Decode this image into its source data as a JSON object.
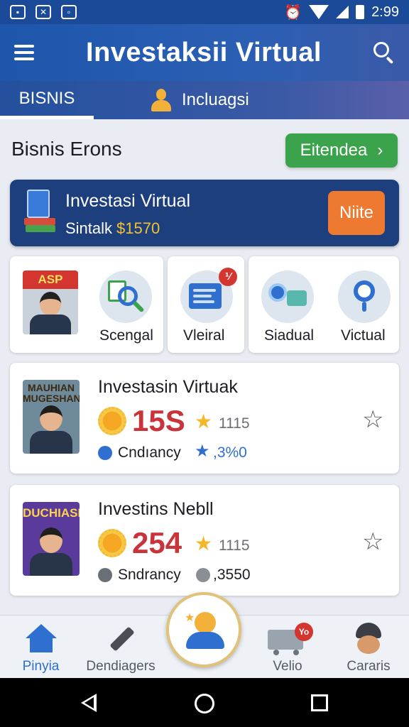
{
  "status_bar": {
    "time": "2:99",
    "icons": [
      "notification-icon",
      "close-box-icon",
      "bag-icon",
      "alarm-icon",
      "wifi-icon",
      "signal-icon",
      "battery-icon"
    ]
  },
  "app_bar": {
    "title": "Investaksii Virtual"
  },
  "tabs": [
    {
      "label": "BISNIS",
      "active": true
    },
    {
      "label": "Incluagsi",
      "active": false
    }
  ],
  "section": {
    "title": "Bisnis Erons",
    "button_label": "Eitendea",
    "button_arrow": "›"
  },
  "banner": {
    "title": "Investasi Virtual",
    "subtitle": "Sintalk",
    "amount": "$1570",
    "button_label": "Niite"
  },
  "grid": {
    "card1": {
      "poster_text": "ASP",
      "label": "Scengal"
    },
    "card2": {
      "label": "Vleiral",
      "badge": "⅟"
    },
    "card3": {
      "label1": "Siadual",
      "label2": "Victual"
    }
  },
  "list": [
    {
      "poster_text": "MAUHIAN MUGESHAND",
      "title": "Investasin Virtuak",
      "score": "15S",
      "count": "1115",
      "meta_label": "Cndıancy",
      "meta_value": ",3%0"
    },
    {
      "poster_text": "DUCHIASI",
      "title": "Investins Nebll",
      "score": "254",
      "count": "1115",
      "meta_label": "Sndrancy",
      "meta_value": ",3550"
    }
  ],
  "bottom_nav": [
    {
      "label": "Pinyia",
      "active": true
    },
    {
      "label": "Dendiagers",
      "active": false
    },
    {
      "label": "",
      "center": true
    },
    {
      "label": "Velio",
      "badge": "Yo"
    },
    {
      "label": "Cararis"
    }
  ],
  "colors": {
    "primary": "#1d56ab",
    "green": "#3aa34b",
    "orange": "#ee7a32",
    "banner": "#1d3f7e",
    "score_red": "#c8343a"
  }
}
